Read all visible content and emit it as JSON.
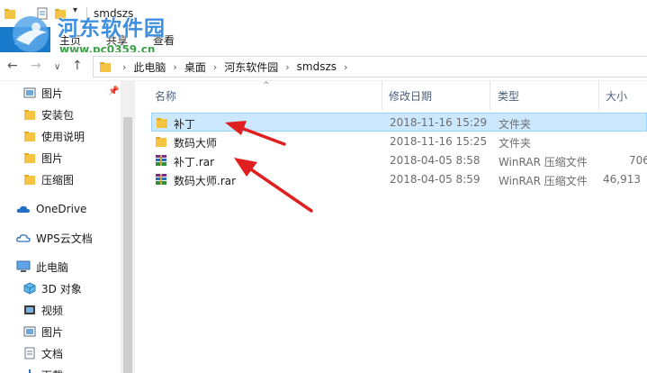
{
  "window": {
    "title": "smdszs"
  },
  "watermark": {
    "title": "河东软件园",
    "url": "www.pc0359.cn"
  },
  "ribbon": {
    "file": "文件",
    "tabs": [
      "主页",
      "共享",
      "查看"
    ]
  },
  "address": {
    "crumbs": [
      "此电脑",
      "桌面",
      "河东软件园",
      "smdszs"
    ]
  },
  "sidebar": {
    "quick": [
      "图片",
      "安装包",
      "使用说明",
      "图片",
      "压缩图"
    ],
    "onedrive": "OneDrive",
    "wps": "WPS云文档",
    "pc": "此电脑",
    "pc_items": [
      "3D 对象",
      "视频",
      "图片",
      "文档",
      "下载"
    ]
  },
  "columns": {
    "name": "名称",
    "date": "修改日期",
    "type": "类型",
    "size": "大小"
  },
  "files": [
    {
      "name": "补丁",
      "date": "2018-11-16 15:29",
      "type": "文件夹",
      "size": "",
      "icon": "folder-icon"
    },
    {
      "name": "数码大师",
      "date": "2018-11-16 15:25",
      "type": "文件夹",
      "size": "",
      "icon": "folder-icon"
    },
    {
      "name": "补丁.rar",
      "date": "2018-04-05 8:58",
      "type": "WinRAR 压缩文件",
      "size": "706",
      "icon": "rar-archive-icon"
    },
    {
      "name": "数码大师.rar",
      "date": "2018-04-05 8:59",
      "type": "WinRAR 压缩文件",
      "size": "46,913",
      "icon": "rar-archive-icon"
    }
  ],
  "colors": {
    "accent": "#1979ca",
    "selection": "#cce8ff",
    "arrow": "#e02020",
    "folder": "#f4c343"
  }
}
